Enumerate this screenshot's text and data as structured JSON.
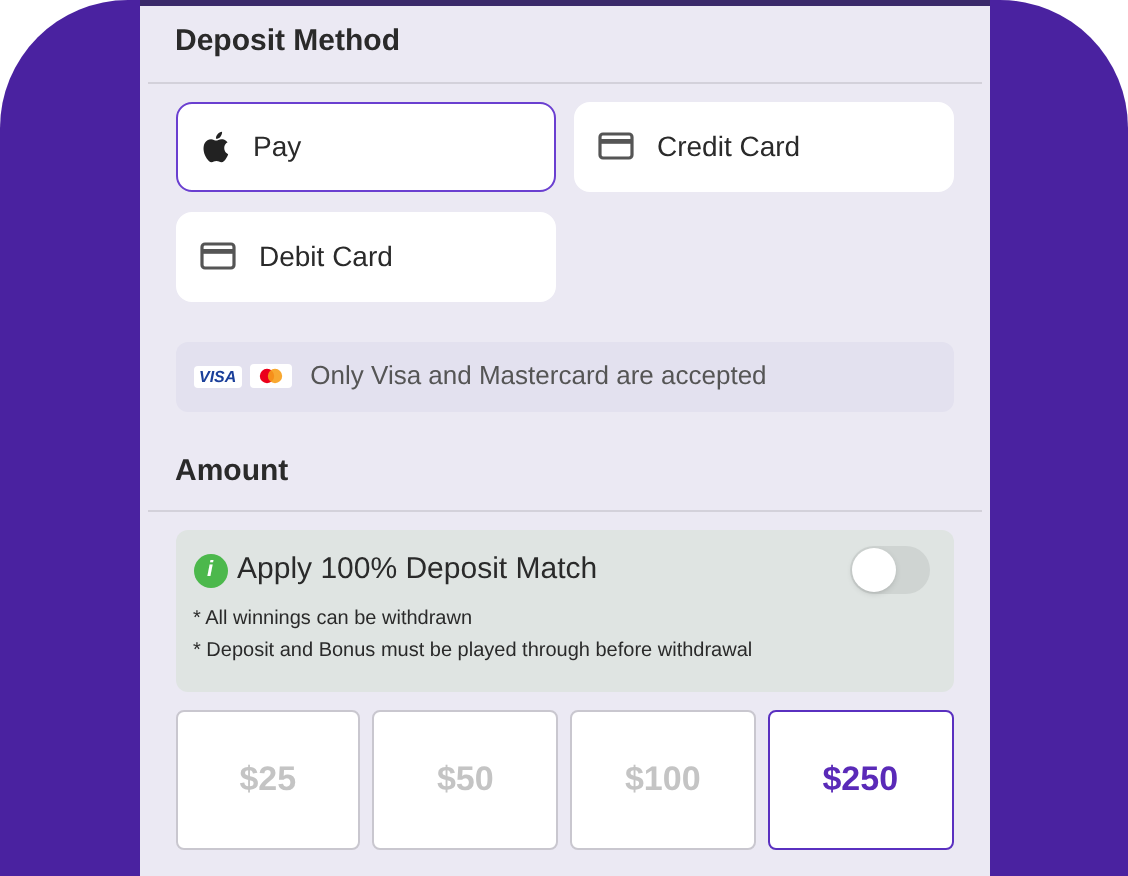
{
  "deposit_method": {
    "title": "Deposit Method",
    "methods": [
      {
        "kind": "apple",
        "label": "Pay",
        "selected": true
      },
      {
        "kind": "card",
        "label": "Credit Card",
        "selected": false
      },
      {
        "kind": "card",
        "label": "Debit Card",
        "selected": false
      }
    ],
    "note": {
      "visa_label": "VISA",
      "text": "Only Visa and Mastercard are accepted"
    }
  },
  "amount": {
    "title": "Amount",
    "bonus": {
      "icon_text": "i",
      "label": "Apply 100% Deposit Match",
      "on": false,
      "terms": [
        "* All winnings can be withdrawn",
        "* Deposit and Bonus must be played through before withdrawal"
      ]
    },
    "options": [
      {
        "label": "$25",
        "selected": false
      },
      {
        "label": "$50",
        "selected": false
      },
      {
        "label": "$100",
        "selected": false
      },
      {
        "label": "$250",
        "selected": true
      }
    ]
  }
}
